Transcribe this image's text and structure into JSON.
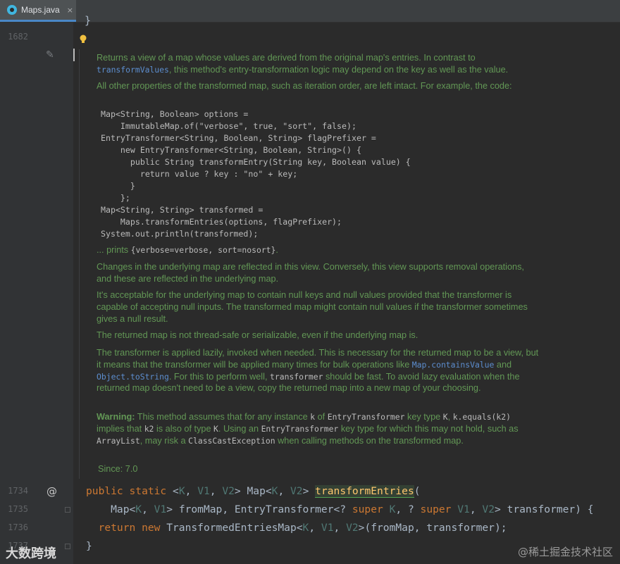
{
  "tab": {
    "label": "Maps.java",
    "close": "×"
  },
  "gutter": {
    "lines": [
      "1682",
      "1734",
      "1735",
      "1736",
      "1737"
    ]
  },
  "doc": {
    "p1a": "Returns a view of a map whose values are derived from the original map's entries. In contrast to",
    "p1link": "transformValues",
    "p1b": ", this method's entry-transformation logic may depend on the key as well as the value.",
    "p2": "All other properties of the transformed map, such as iteration order, are left intact. For example, the code:",
    "code_lines": [
      "Map<String, Boolean> options =",
      "    ImmutableMap.of(\"verbose\", true, \"sort\", false);",
      "EntryTransformer<String, Boolean, String> flagPrefixer =",
      "    new EntryTransformer<String, Boolean, String>() {",
      "      public String transformEntry(String key, Boolean value) {",
      "        return value ? key : \"no\" + key;",
      "      }",
      "    };",
      "Map<String, String> transformed =",
      "    Maps.transformEntries(options, flagPrefixer);",
      "System.out.println(transformed);"
    ],
    "prints_prefix": "... prints ",
    "prints_code": "{verbose=verbose, sort=nosort}",
    "prints_suffix": ".",
    "p3": "Changes in the underlying map are reflected in this view. Conversely, this view supports removal operations, and these are reflected in the underlying map.",
    "p4": "It's acceptable for the underlying map to contain null keys and null values provided that the transformer is capable of accepting null inputs. The transformed map might contain null values if the transformer sometimes gives a null result.",
    "p5": "The returned map is not thread-safe or serializable, even if the underlying map is.",
    "p6a": "The transformer is applied lazily, invoked when needed. This is necessary for the returned map to be a view, but it means that the transformer will be applied many times for bulk operations like ",
    "p6link1": "Map.containsValue",
    "p6b": " and ",
    "p6link2": "Object.toString",
    "p6c": ". For this to perform well, ",
    "p6code": "transformer",
    "p6d": " should be fast. To avoid lazy evaluation when the returned map doesn't need to be a view, copy the returned map into a new map of your choosing.",
    "warn_label": "Warning:",
    "w1": " This method assumes that for any instance ",
    "wk": "k",
    "w2": " of ",
    "wET": "EntryTransformer",
    "w3": " key type ",
    "wK": "K",
    "w4": ", ",
    "wkeq": "k.equals(k2)",
    "w5": " implies that ",
    "wk2": "k2",
    "w6": " is also of type ",
    "wK2": "K",
    "w7": ". Using an ",
    "wET2": "EntryTransformer",
    "w8": " key type for which this may not hold, such as ",
    "wAL": "ArrayList",
    "w9": ", may risk a ",
    "wCCE": "ClassCastException",
    "w10": " when calling methods on the transformed map.",
    "since": "Since: 7.0"
  },
  "source": {
    "l1_kw": "public static ",
    "l1_a": "<",
    "l1_K": "K",
    "l1_b": ", ",
    "l1_V1": "V1",
    "l1_c": ", ",
    "l1_V2": "V2",
    "l1_d": "> Map<",
    "l1_K2": "K",
    "l1_e": ", ",
    "l1_V2b": "V2",
    "l1_f": "> ",
    "l1_fn": "transformEntries",
    "l1_g": "(",
    "l2_a": "    Map<",
    "l2_K": "K",
    "l2_b": ", ",
    "l2_V1": "V1",
    "l2_c": "> fromMap, EntryTransformer<? ",
    "l2_super1": "super",
    "l2_d": " ",
    "l2_K2": "K",
    "l2_e": ", ? ",
    "l2_super2": "super",
    "l2_f": " ",
    "l2_V1b": "V1",
    "l2_g": ", ",
    "l2_V2": "V2",
    "l2_h": "> transformer) {",
    "l3_a": "  ",
    "l3_return": "return",
    "l3_b": " ",
    "l3_new": "new",
    "l3_c": " TransformedEntriesMap<",
    "l3_K": "K",
    "l3_d": ", ",
    "l3_V1": "V1",
    "l3_e": ", ",
    "l3_V2": "V2",
    "l3_f": ">(fromMap, transformer);",
    "l4": "}"
  },
  "watermark": {
    "left": "大数跨境",
    "right": "@稀土掘金技术社区"
  }
}
